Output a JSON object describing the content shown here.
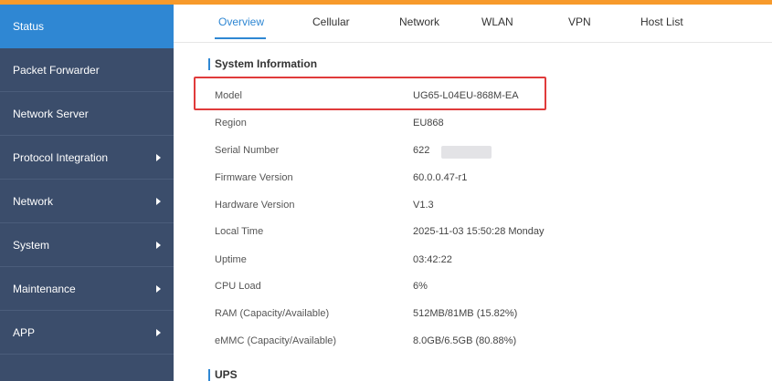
{
  "sidebar": {
    "items": [
      {
        "label": "Status",
        "active": true,
        "has_submenu": false
      },
      {
        "label": "Packet Forwarder",
        "active": false,
        "has_submenu": false
      },
      {
        "label": "Network Server",
        "active": false,
        "has_submenu": false
      },
      {
        "label": "Protocol Integration",
        "active": false,
        "has_submenu": true
      },
      {
        "label": "Network",
        "active": false,
        "has_submenu": true
      },
      {
        "label": "System",
        "active": false,
        "has_submenu": true
      },
      {
        "label": "Maintenance",
        "active": false,
        "has_submenu": true
      },
      {
        "label": "APP",
        "active": false,
        "has_submenu": true
      }
    ]
  },
  "tabs": [
    {
      "label": "Overview",
      "active": true
    },
    {
      "label": "Cellular",
      "active": false
    },
    {
      "label": "Network",
      "active": false
    },
    {
      "label": "WLAN",
      "active": false
    },
    {
      "label": "VPN",
      "active": false
    },
    {
      "label": "Host List",
      "active": false
    }
  ],
  "system_information": {
    "title": "System Information",
    "rows": [
      {
        "label": "Model",
        "value": "UG65-L04EU-868M-EA"
      },
      {
        "label": "Region",
        "value": "EU868"
      },
      {
        "label": "Serial Number",
        "value": "622"
      },
      {
        "label": "Firmware Version",
        "value": "60.0.0.47-r1"
      },
      {
        "label": "Hardware Version",
        "value": "V1.3"
      },
      {
        "label": "Local Time",
        "value": "2025-11-03 15:50:28 Monday"
      },
      {
        "label": "Uptime",
        "value": "03:42:22"
      },
      {
        "label": "CPU Load",
        "value": "6%"
      },
      {
        "label": "RAM (Capacity/Available)",
        "value": "512MB/81MB (15.82%)"
      },
      {
        "label": "eMMC (Capacity/Available)",
        "value": "8.0GB/6.5GB (80.88%)"
      }
    ]
  },
  "ups": {
    "title": "UPS"
  },
  "colors": {
    "accent": "#2f87d3",
    "sidebar_bg": "#3b4d6b",
    "top_bar": "#f79a2b",
    "highlight_box": "#e03b3b"
  }
}
